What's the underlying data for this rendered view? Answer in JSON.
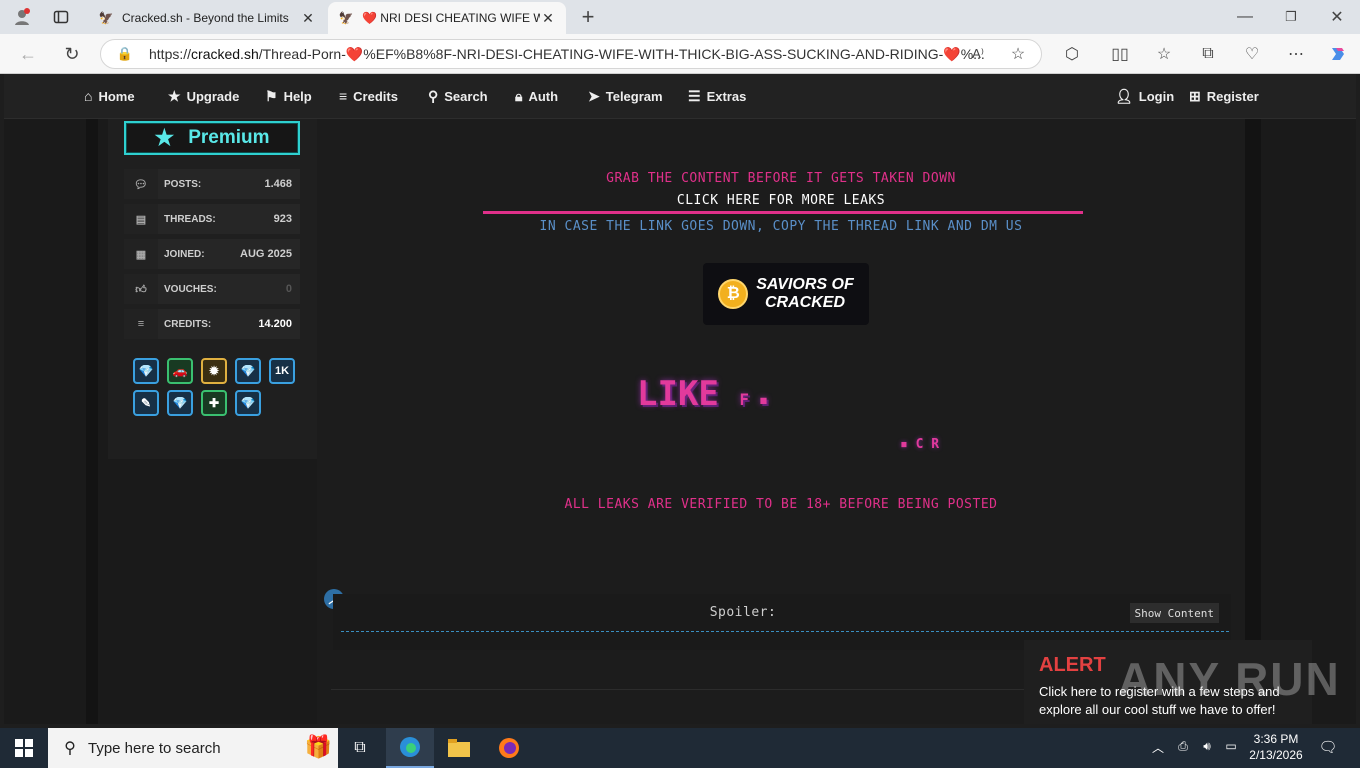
{
  "browser": {
    "tabs": [
      {
        "title": "Cracked.sh - Beyond the Limits",
        "active": false
      },
      {
        "title": "❤️ NRI DESI CHEATING WIFE WIT",
        "active": true
      }
    ],
    "url_prefix": "https://",
    "url_host": "cracked.sh",
    "url_path": "/Thread-Porn-❤️%EF%B8%8F-NRI-DESI-CHEATING-WIFE-WITH-THICK-BIG-ASS-SUCKING-AND-RIDING-❤️%..."
  },
  "nav": {
    "home": "Home",
    "upgrade": "Upgrade",
    "help": "Help",
    "credits": "Credits",
    "search": "Search",
    "auth": "Auth",
    "telegram": "Telegram",
    "extras": "Extras",
    "login": "Login",
    "register": "Register"
  },
  "sidebar": {
    "rank": "Premium",
    "stats": [
      {
        "label": "POSTS:",
        "value": "1.468",
        "icon": "comments-icon"
      },
      {
        "label": "THREADS:",
        "value": "923",
        "icon": "book-icon"
      },
      {
        "label": "JOINED:",
        "value": "AUG 2025",
        "icon": "calendar-icon"
      },
      {
        "label": "VOUCHES:",
        "value": "0",
        "icon": "thumbs-up-icon"
      },
      {
        "label": "CREDITS:",
        "value": "14.200",
        "icon": "coins-icon"
      }
    ],
    "badge_1k": "1K"
  },
  "post": {
    "line1": "GRAB THE CONTENT BEFORE IT GETS TAKEN DOWN",
    "line2": "CLICK HERE FOR MORE LEAKS",
    "line3": "IN CASE THE LINK GOES DOWN, COPY THE THREAD LINK AND DM US",
    "logo_line1": "SAVIORS OF",
    "logo_line2": "CRACKED",
    "like_text": "LIKE",
    "like_small": "F ▪",
    "like_small2": "▪ C R",
    "verified": "ALL LEAKS ARE VERIFIED TO BE 18+ BEFORE BEING POSTED",
    "spoiler_label": "Spoiler:",
    "show_content": "Show Content"
  },
  "alert": {
    "title": "ALERT",
    "body": "Click here to register with a few steps and explore all our cool stuff we have to offer!"
  },
  "watermark": "ANY RUN",
  "taskbar": {
    "search_placeholder": "Type here to search",
    "time": "3:36 PM",
    "date": "2/13/2026"
  },
  "colors": {
    "pink": "#e0308a",
    "blue_text": "#5a8fc8",
    "teal": "#2fd0d0",
    "alert_red": "#e34141"
  }
}
